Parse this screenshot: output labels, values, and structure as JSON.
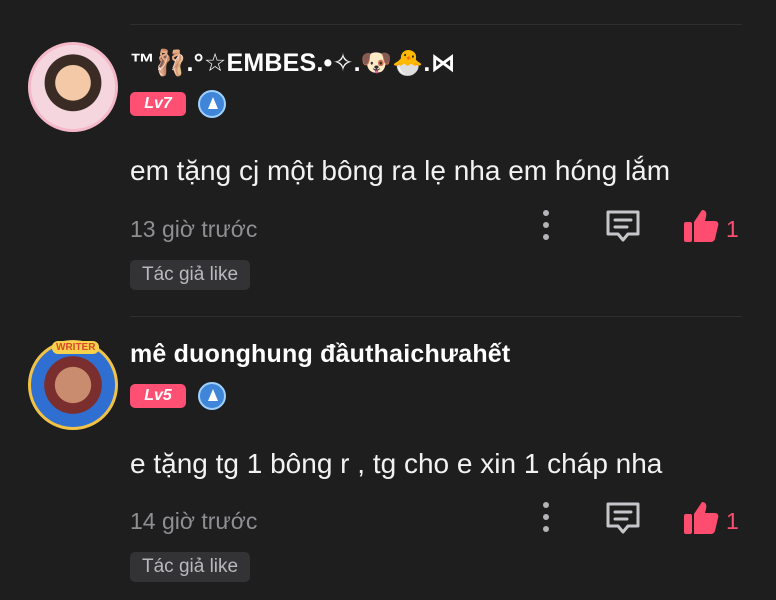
{
  "comments": [
    {
      "username": "™🩰.°☆EMBES.•✧.🐶🐣.⋈",
      "level": "Lv7",
      "text": "em tặng cj một bông ra lẹ nha em hóng lắm",
      "time": "13 giờ trước",
      "like_count": "1",
      "tag": "Tác giả like"
    },
    {
      "username": "mê duonghung đầuthaichưahết",
      "avatar_badge": "WRITER",
      "level": "Lv5",
      "text": "e tặng tg 1 bông r , tg cho e xin 1 cháp nha",
      "time": "14 giờ trước",
      "like_count": "1",
      "tag": "Tác giả like"
    }
  ],
  "colors": {
    "background": "#1e1e1f",
    "level_badge": "#ff4f73",
    "like_accent": "#ff4d70",
    "muted_text": "#8f8f93"
  },
  "icons": [
    "more-vertical-icon",
    "reply-comment-icon",
    "thumbs-up-icon",
    "medal-icon"
  ]
}
